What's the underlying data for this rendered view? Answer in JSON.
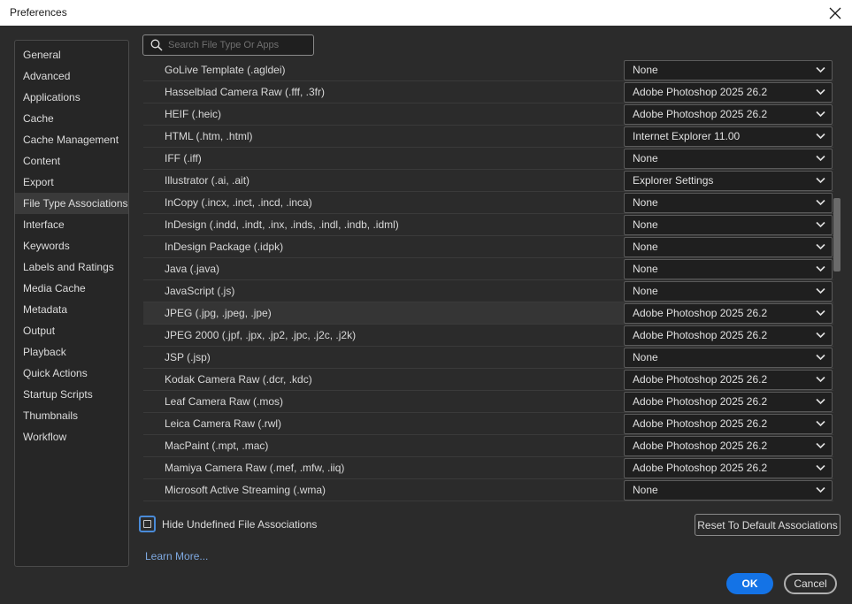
{
  "window": {
    "title": "Preferences"
  },
  "sidebar": {
    "items": [
      {
        "label": "General"
      },
      {
        "label": "Advanced"
      },
      {
        "label": "Applications"
      },
      {
        "label": "Cache"
      },
      {
        "label": "Cache Management"
      },
      {
        "label": "Content"
      },
      {
        "label": "Export"
      },
      {
        "label": "File Type Associations",
        "selected": true
      },
      {
        "label": "Interface"
      },
      {
        "label": "Keywords"
      },
      {
        "label": "Labels and Ratings"
      },
      {
        "label": "Media Cache"
      },
      {
        "label": "Metadata"
      },
      {
        "label": "Output"
      },
      {
        "label": "Playback"
      },
      {
        "label": "Quick Actions"
      },
      {
        "label": "Startup Scripts"
      },
      {
        "label": "Thumbnails"
      },
      {
        "label": "Workflow"
      }
    ]
  },
  "search": {
    "placeholder": "Search File Type Or Apps",
    "value": ""
  },
  "associations": [
    {
      "file_type": "GoLive Template (.agldei)",
      "app": "None"
    },
    {
      "file_type": "Hasselblad Camera Raw (.fff, .3fr)",
      "app": "Adobe Photoshop 2025 26.2"
    },
    {
      "file_type": "HEIF (.heic)",
      "app": "Adobe Photoshop 2025 26.2"
    },
    {
      "file_type": "HTML (.htm, .html)",
      "app": "Internet Explorer 11.00"
    },
    {
      "file_type": "IFF (.iff)",
      "app": "None"
    },
    {
      "file_type": "Illustrator (.ai, .ait)",
      "app": "Explorer Settings"
    },
    {
      "file_type": "InCopy (.incx, .inct, .incd, .inca)",
      "app": "None"
    },
    {
      "file_type": "InDesign (.indd, .indt, .inx, .inds, .indl, .indb, .idml)",
      "app": "None"
    },
    {
      "file_type": "InDesign Package (.idpk)",
      "app": "None"
    },
    {
      "file_type": "Java (.java)",
      "app": "None"
    },
    {
      "file_type": "JavaScript (.js)",
      "app": "None"
    },
    {
      "file_type": "JPEG (.jpg, .jpeg, .jpe)",
      "app": "Adobe Photoshop 2025 26.2",
      "highlighted": true
    },
    {
      "file_type": "JPEG 2000 (.jpf, .jpx, .jp2, .jpc, .j2c, .j2k)",
      "app": "Adobe Photoshop 2025 26.2"
    },
    {
      "file_type": "JSP (.jsp)",
      "app": "None"
    },
    {
      "file_type": "Kodak Camera Raw (.dcr, .kdc)",
      "app": "Adobe Photoshop 2025 26.2"
    },
    {
      "file_type": "Leaf Camera Raw (.mos)",
      "app": "Adobe Photoshop 2025 26.2"
    },
    {
      "file_type": "Leica Camera Raw (.rwl)",
      "app": "Adobe Photoshop 2025 26.2"
    },
    {
      "file_type": "MacPaint (.mpt, .mac)",
      "app": "Adobe Photoshop 2025 26.2"
    },
    {
      "file_type": "Mamiya Camera Raw (.mef, .mfw, .iiq)",
      "app": "Adobe Photoshop 2025 26.2"
    },
    {
      "file_type": "Microsoft Active Streaming (.wma)",
      "app": "None"
    }
  ],
  "hide_undefined": {
    "label": "Hide Undefined File Associations",
    "checked": false
  },
  "reset_label": "Reset To Default Associations",
  "learn_more_label": "Learn More...",
  "ok_label": "OK",
  "cancel_label": "Cancel",
  "colors": {
    "accent": "#1473e6",
    "background": "#2b2b2b",
    "focus_ring": "#4a8bd8",
    "link": "#7ea8e0"
  },
  "icons": {
    "close": "close-icon",
    "search": "search-icon",
    "dropdown": "chevron-down-icon"
  }
}
